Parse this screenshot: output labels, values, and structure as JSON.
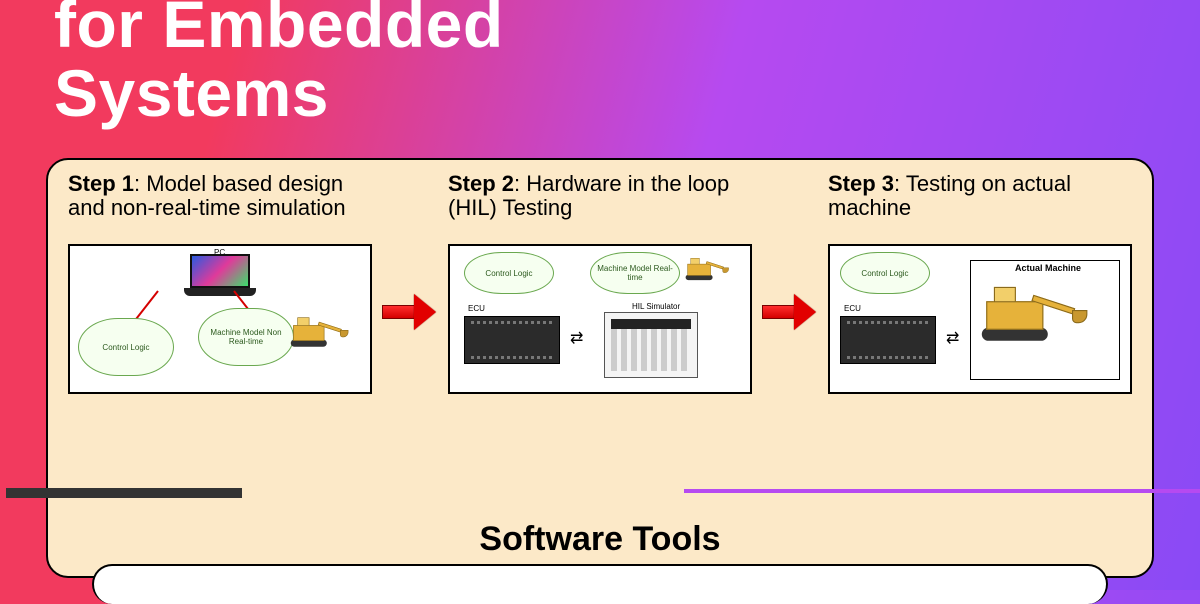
{
  "title_line1": "for Embedded",
  "title_line2": "Systems",
  "steps": [
    {
      "label": "Step 1",
      "desc": ": Model based design and non-real-time simulation",
      "cloud_left": "Control Logic",
      "cloud_right": "Machine Model Non Real-time",
      "top_label": "PC"
    },
    {
      "label": "Step 2",
      "desc": ": Hardware in the loop (HIL) Testing",
      "cloud_left": "Control Logic",
      "cloud_right": "Machine Model Real-time",
      "ecu_label": "ECU",
      "hil_label": "HIL Simulator"
    },
    {
      "label": "Step 3",
      "desc": ": Testing on actual machine",
      "cloud_left": "Control Logic",
      "ecu_label": "ECU",
      "machine_label": "Actual Machine"
    }
  ],
  "tools_heading": "Software Tools"
}
